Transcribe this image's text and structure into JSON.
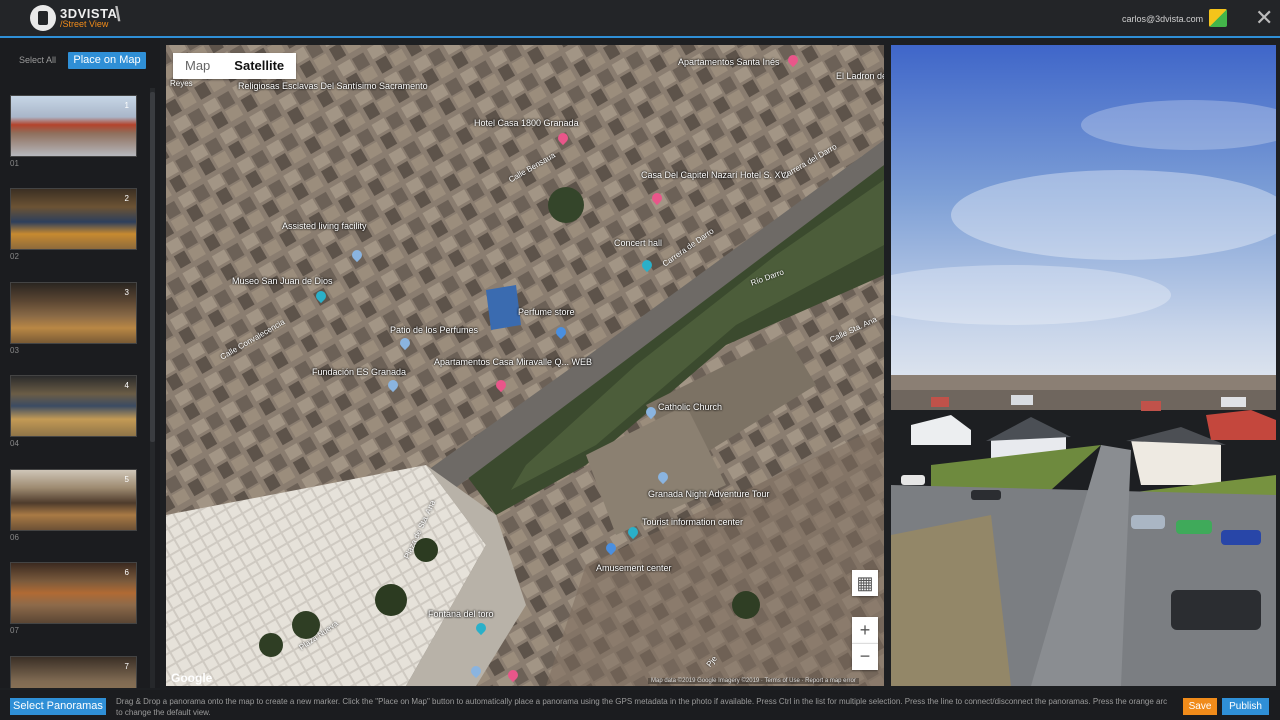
{
  "app": {
    "brand": "3DVISTA",
    "module": "/Street View",
    "user_email": "carlos@3dvista.com"
  },
  "sidebar": {
    "select_all": "Select All",
    "place_on_map": "Place on Map",
    "thumbnails": [
      {
        "num": "1",
        "label": "01"
      },
      {
        "num": "2",
        "label": "02"
      },
      {
        "num": "3",
        "label": "03"
      },
      {
        "num": "4",
        "label": "04"
      },
      {
        "num": "5",
        "label": "06"
      },
      {
        "num": "6",
        "label": "07"
      },
      {
        "num": "7",
        "label": ""
      }
    ]
  },
  "map": {
    "tabs": [
      "Map",
      "Satellite"
    ],
    "active_tab": "Satellite",
    "google": "Google",
    "attribution": "Map data ©2019 Google Imagery ©2019 · Terms of Use · Report a map error",
    "places": [
      "Religiosas Esclavas Del Santísimo Sacramento",
      "Hotel Casa 1800 Granada",
      "Apartamentos Santa Inés",
      "El Ladron de",
      "Casa Del Capitel Nazarí Hotel S. XVI",
      "Assisted living facility",
      "Concert hall",
      "Museo San Juan de Dios",
      "Perfume store",
      "Patio de los Perfumes",
      "Fundación ES Granada",
      "Apartamentos Casa Miravalle Q... WEB",
      "Catholic Church",
      "Granada Night Adventure Tour",
      "Tourist information center",
      "Amusement center",
      "Fontana del toro"
    ],
    "streets": [
      "Reyes",
      "Calle Bensaua",
      "Carrera del Darro",
      "Carrera de Darro",
      "Río Darro",
      "Calle Convalecencia",
      "Calle Sta. Ana",
      "Plaza de Sta. Ana",
      "Plaza Nueva",
      "Pje"
    ]
  },
  "bottom": {
    "select_panoramas": "Select Panoramas",
    "help": "Drag & Drop a panorama onto the map to create a new marker. Click the \"Place on Map\" button to automatically place a panorama using the GPS metadata in the photo if available. Press Ctrl in the list for multiple selection. Press the line to connect/disconnect the panoramas. Press the orange arc to change the default view.",
    "save": "Save",
    "publish": "Publish"
  },
  "colors": {
    "accent": "#2f8fd6",
    "save": "#f08b1a"
  },
  "icons": [
    "3dvista-logo-icon",
    "user-icon",
    "close-icon",
    "fullscreen-icon",
    "zoom-in-icon",
    "zoom-out-icon",
    "map-pin-icon"
  ]
}
